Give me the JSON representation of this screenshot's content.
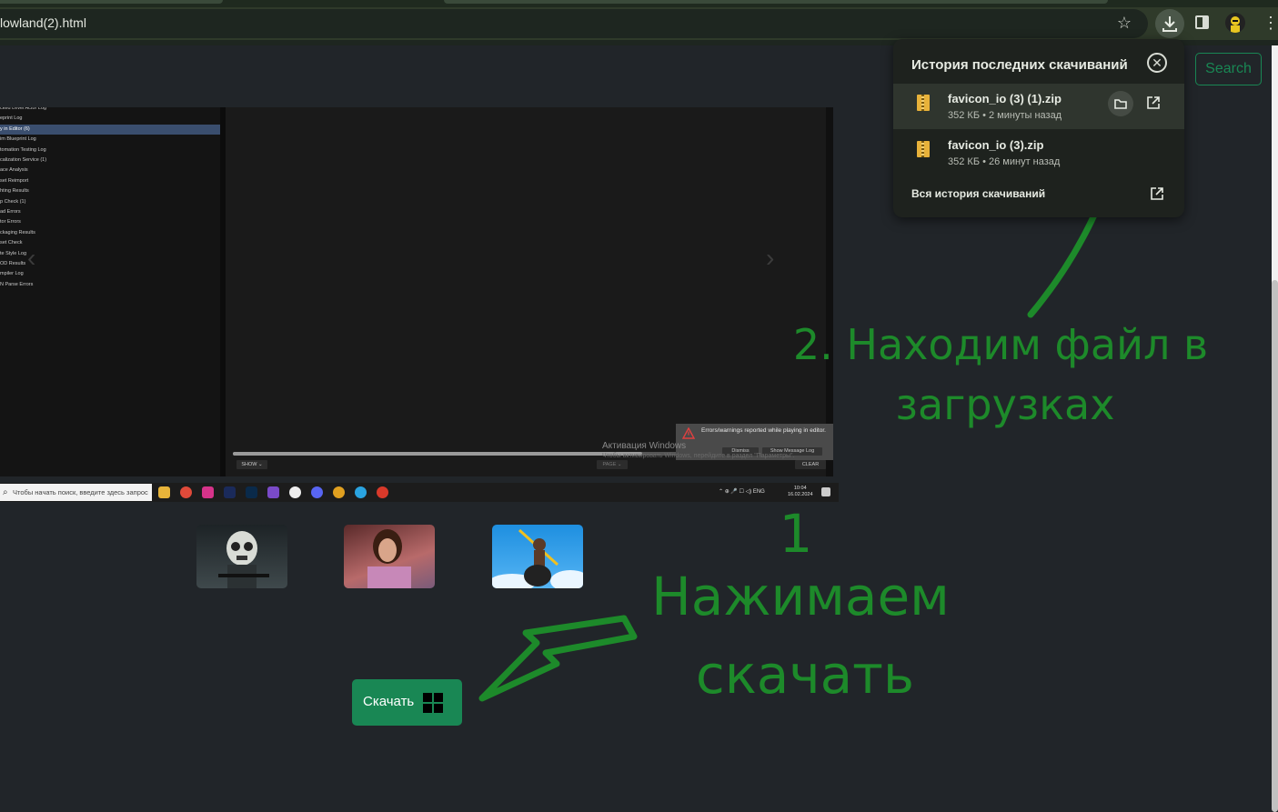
{
  "browser": {
    "url": "lowland(2).html",
    "star_icon": "star-icon",
    "download_icon": "download-icon",
    "menu_icon": "kebab-menu-icon"
  },
  "page": {
    "search_label": "Search",
    "download_button_label": "Скачать",
    "accent_color": "#198754"
  },
  "embedded_screenshot": {
    "log_items": [
      "cked Level Actor Log",
      "eprint Log",
      "y in Editor (6)",
      "im Blueprint Log",
      "tomation Testing Log",
      "calization Service (1)",
      "ace Analysis",
      "set Reimport",
      "hting Results",
      "p Check (1)",
      "ad Errors",
      "tor Errors",
      "ckaging Results",
      "set Check",
      "te Style Log",
      "OD Results",
      "mpiler Log",
      "N Parse Errors"
    ],
    "selected_index": 2,
    "show_button": "SHOW ⌄",
    "page_button": "PAGE ⌄",
    "clear_button": "CLEAR",
    "warning_text": "Errors/warnings reported while playing in editor.",
    "dismiss_button": "Dismiss",
    "show_log_button": "Show Message Log",
    "activation_title": "Активация Windows",
    "activation_sub": "Чтобы активировать Windows, перейдите в раздел \"Параметры\".",
    "taskbar_search": "Чтобы начать поиск, введите здесь запрос",
    "tray_text": "⌃ ⊕ 🎤 ☐ ◁)  ENG",
    "clock_time": "10:04",
    "clock_date": "16.02.2024"
  },
  "annotations": {
    "step1_number": "1",
    "step1_line1": "Нажимаем",
    "step1_line2": "скачать",
    "step2_line1": "2. Находим файл в",
    "step2_line2": "загрузках"
  },
  "downloads_popup": {
    "title": "История последних скачиваний",
    "items": [
      {
        "name": "favicon_io (3) (1).zip",
        "meta": "352 КБ • 2 минуты назад"
      },
      {
        "name": "favicon_io (3).zip",
        "meta": "352 КБ • 26 минут назад"
      }
    ],
    "all_history": "Вся история скачиваний"
  }
}
